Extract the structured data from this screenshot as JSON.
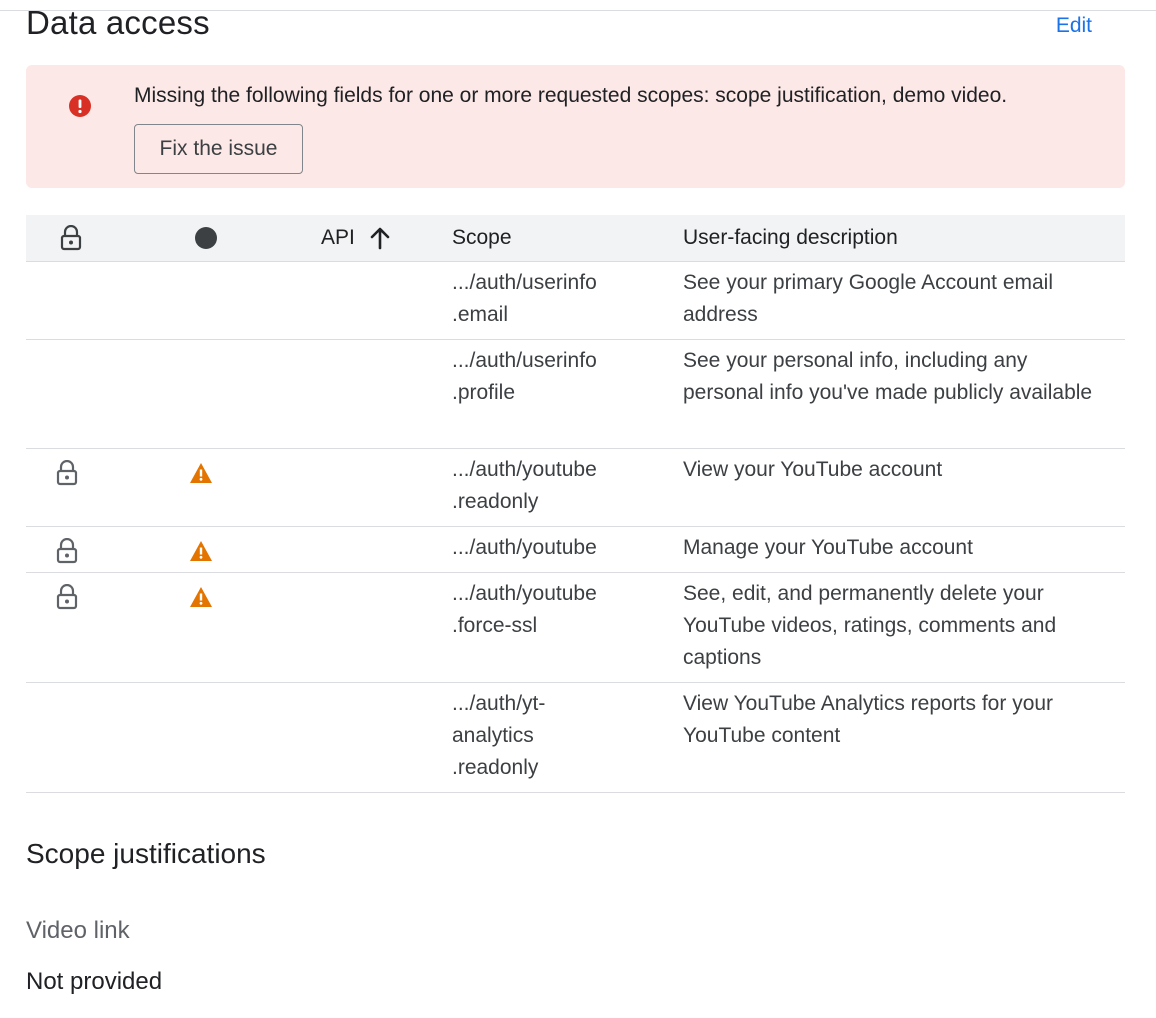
{
  "section": {
    "title": "Data access",
    "edit_label": "Edit"
  },
  "error_banner": {
    "message": "Missing the following fields for one or more requested scopes: scope justification, demo video.",
    "fix_button_label": "Fix the issue",
    "icon": "error-icon",
    "background_color": "#fce8e6",
    "icon_color": "#d93025"
  },
  "table": {
    "headers": {
      "lock_icon": "lock-icon",
      "status_icon": "status-dot-icon",
      "api": "API",
      "api_sort_icon": "arrow-up-icon",
      "scope": "Scope",
      "description": "User-facing description"
    },
    "rows": [
      {
        "locked": false,
        "warning": false,
        "scope_lines": [
          ".../auth/userinfo",
          ".email"
        ],
        "description": "See your primary Google Account email address"
      },
      {
        "locked": false,
        "warning": false,
        "scope_lines": [
          ".../auth/userinfo",
          ".profile"
        ],
        "description": "See your personal info, including any personal info you've made publicly available"
      },
      {
        "locked": true,
        "warning": true,
        "scope_lines": [
          ".../auth/youtube",
          ".readonly"
        ],
        "description": "View your YouTube account"
      },
      {
        "locked": true,
        "warning": true,
        "scope_lines": [
          ".../auth/youtube"
        ],
        "description": "Manage your YouTube account"
      },
      {
        "locked": true,
        "warning": true,
        "scope_lines": [
          ".../auth/youtube",
          ".force-ssl"
        ],
        "description": "See, edit, and permanently delete your YouTube videos, ratings, comments and captions"
      },
      {
        "locked": false,
        "warning": false,
        "scope_lines": [
          ".../auth/yt-",
          "analytics",
          ".readonly"
        ],
        "description": "View YouTube Analytics reports for your YouTube content"
      }
    ],
    "warning_color": "#e37400"
  },
  "justifications": {
    "title": "Scope justifications",
    "video_link_label": "Video link",
    "video_link_value": "Not provided"
  }
}
